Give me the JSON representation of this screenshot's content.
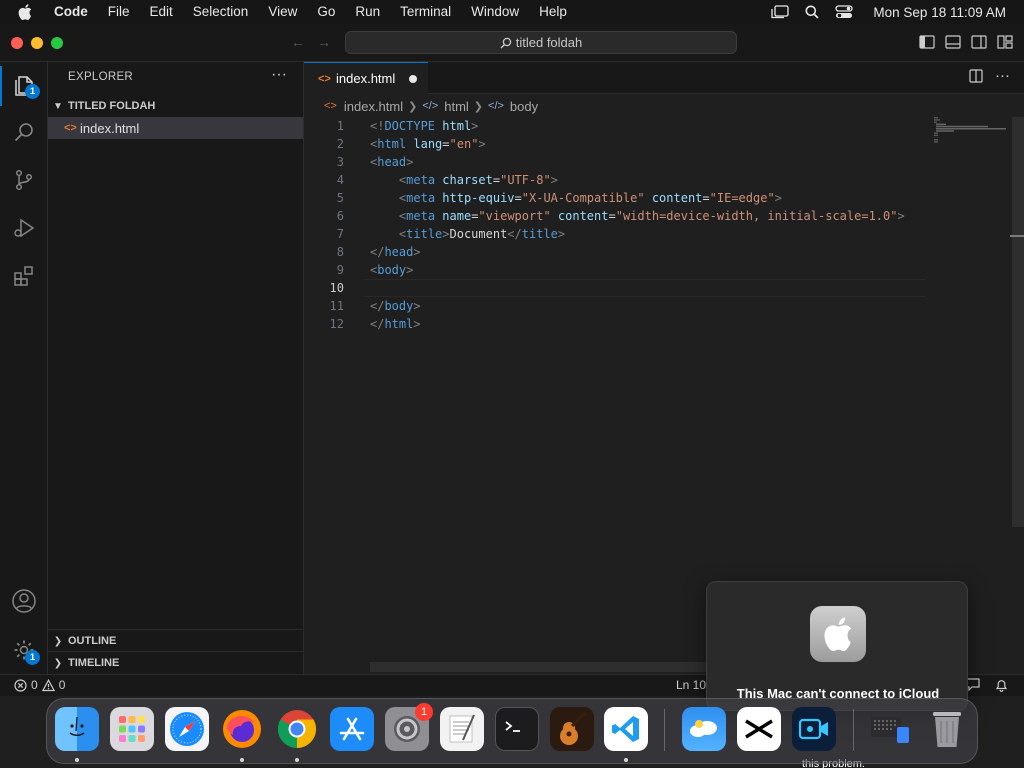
{
  "menubar": {
    "app": "Code",
    "items": [
      "File",
      "Edit",
      "Selection",
      "View",
      "Go",
      "Run",
      "Terminal",
      "Window",
      "Help"
    ],
    "clock": "Mon Sep 18  11:09 AM"
  },
  "titlebar": {
    "search_text": "titled foldah"
  },
  "activity": {
    "explorer_badge": "1",
    "settings_badge": "1"
  },
  "sidebar": {
    "header": "EXPLORER",
    "more": "···",
    "folder": "TITLED FOLDAH",
    "file": "index.html",
    "outline": "OUTLINE",
    "timeline": "TIMELINE"
  },
  "editor": {
    "tab_label": "index.html",
    "breadcrumb": [
      "index.html",
      "html",
      "body"
    ],
    "current_line": 10,
    "line_numbers": [
      "1",
      "2",
      "3",
      "4",
      "5",
      "6",
      "7",
      "8",
      "9",
      "10",
      "11",
      "12"
    ]
  },
  "status": {
    "errors": "0",
    "warnings": "0",
    "position": "Ln 10"
  },
  "notification": {
    "title": "This Mac can't connect to iCloud",
    "below_text": "this problem."
  },
  "dock": {
    "settings_badge": "1"
  },
  "colors": {
    "accent": "#0078d4",
    "tag": "#569cd6",
    "attr": "#9cdcfe",
    "string": "#ce9178"
  }
}
